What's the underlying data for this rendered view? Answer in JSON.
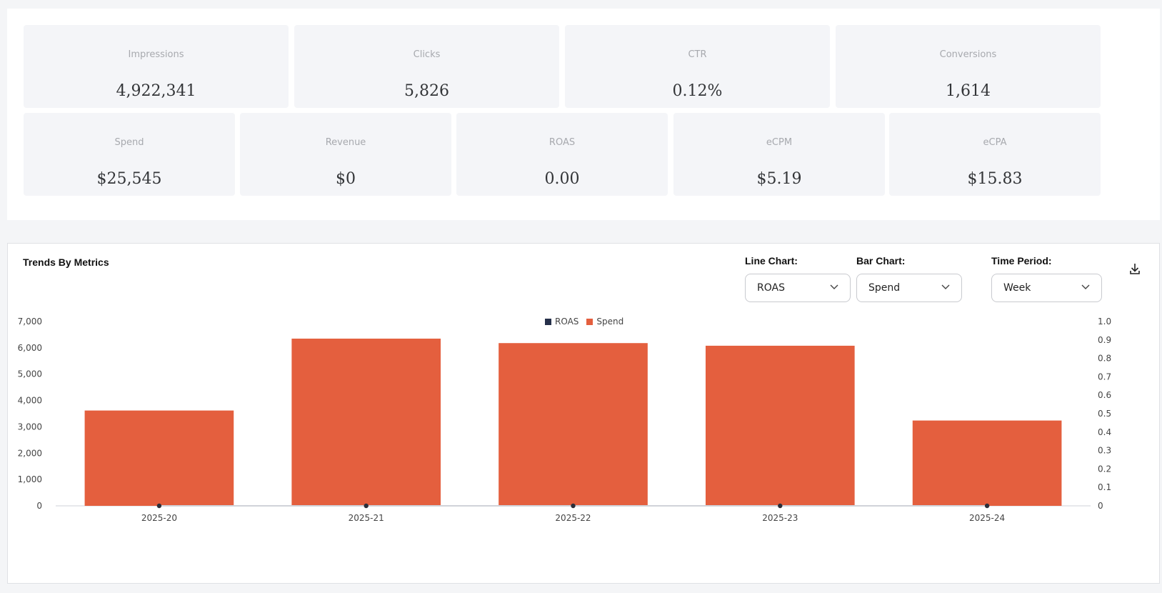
{
  "kpis_row1": [
    {
      "label": "Impressions",
      "value": "4,922,341"
    },
    {
      "label": "Clicks",
      "value": "5,826"
    },
    {
      "label": "CTR",
      "value": "0.12%"
    },
    {
      "label": "Conversions",
      "value": "1,614"
    }
  ],
  "kpis_row2": [
    {
      "label": "Spend",
      "value": "$25,545"
    },
    {
      "label": "Revenue",
      "value": "$0"
    },
    {
      "label": "ROAS",
      "value": "0.00"
    },
    {
      "label": "eCPM",
      "value": "$5.19"
    },
    {
      "label": "eCPA",
      "value": "$15.83"
    }
  ],
  "trends": {
    "title": "Trends By Metrics",
    "line_chart_label": "Line Chart:",
    "line_chart_value": "ROAS",
    "bar_chart_label": "Bar Chart:",
    "bar_chart_value": "Spend",
    "time_period_label": "Time Period:",
    "time_period_value": "Week",
    "download_icon": "download-icon",
    "chevron_icon": "chevron-down-icon"
  },
  "colors": {
    "bar": "#e45f3e",
    "line": "#2b2f3a",
    "roas_legend": "#26304a"
  },
  "chart_data": {
    "type": "bar",
    "categories": [
      "2025-20",
      "2025-21",
      "2025-22",
      "2025-23",
      "2025-24"
    ],
    "series": [
      {
        "name": "Spend",
        "type": "bar",
        "axis": "left",
        "values": [
          3620,
          6350,
          6180,
          6080,
          3240
        ]
      },
      {
        "name": "ROAS",
        "type": "line",
        "axis": "right",
        "values": [
          0,
          0,
          0,
          0,
          0
        ]
      }
    ],
    "legend": [
      "ROAS",
      "Spend"
    ],
    "legend_position": "top-center",
    "ylim_left": [
      0,
      7000
    ],
    "yticks_left": [
      "0",
      "1,000",
      "2,000",
      "3,000",
      "4,000",
      "5,000",
      "6,000",
      "7,000"
    ],
    "ylim_right": [
      0,
      1.0
    ],
    "yticks_right": [
      "0",
      "0.1",
      "0.2",
      "0.3",
      "0.4",
      "0.5",
      "0.6",
      "0.7",
      "0.8",
      "0.9",
      "1.0"
    ],
    "grid": false
  }
}
